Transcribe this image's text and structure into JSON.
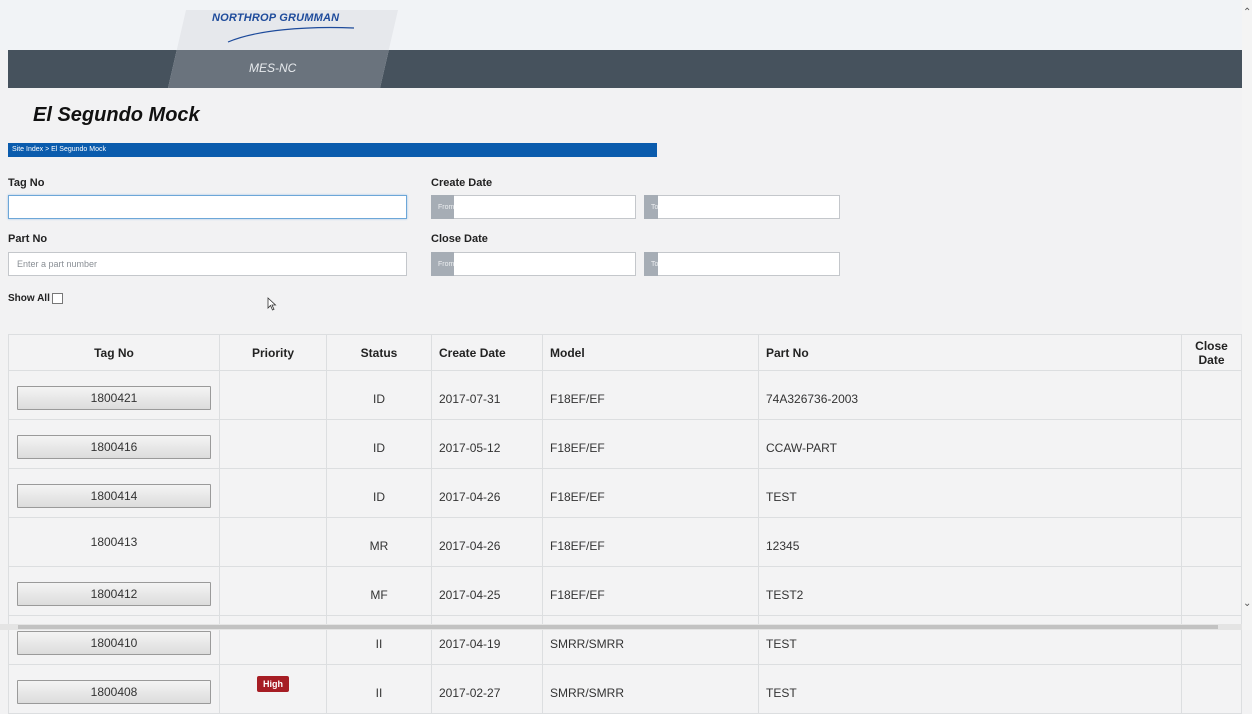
{
  "header": {
    "logo_text": "NORTHROP GRUMMAN",
    "app_name": "MES-NC"
  },
  "page": {
    "title": "El Segundo Mock",
    "breadcrumb": "Site Index > El Segundo Mock"
  },
  "filters": {
    "tag_no_label": "Tag No",
    "tag_no_value": "",
    "part_no_label": "Part No",
    "part_no_placeholder": "Enter a part number",
    "create_date_label": "Create Date",
    "close_date_label": "Close Date",
    "from_label": "From",
    "to_label": "To",
    "show_all_label": "Show All",
    "show_all_checked": false
  },
  "table": {
    "headers": [
      "Tag No",
      "Priority",
      "Status",
      "Create Date",
      "Model",
      "Part No",
      "Close Date"
    ],
    "rows": [
      {
        "tag": "1800421",
        "tag_button": true,
        "priority": "",
        "status": "ID",
        "create_date": "2017-07-31",
        "model": "F18EF/EF",
        "part_no": "74A326736-2003",
        "close_date": ""
      },
      {
        "tag": "1800416",
        "tag_button": true,
        "priority": "",
        "status": "ID",
        "create_date": "2017-05-12",
        "model": "F18EF/EF",
        "part_no": "CCAW-PART",
        "close_date": ""
      },
      {
        "tag": "1800414",
        "tag_button": true,
        "priority": "",
        "status": "ID",
        "create_date": "2017-04-26",
        "model": "F18EF/EF",
        "part_no": "TEST",
        "close_date": ""
      },
      {
        "tag": "1800413",
        "tag_button": false,
        "priority": "",
        "status": "MR",
        "create_date": "2017-04-26",
        "model": "F18EF/EF",
        "part_no": "12345",
        "close_date": ""
      },
      {
        "tag": "1800412",
        "tag_button": true,
        "priority": "",
        "status": "MF",
        "create_date": "2017-04-25",
        "model": "F18EF/EF",
        "part_no": "TEST2",
        "close_date": ""
      },
      {
        "tag": "1800410",
        "tag_button": true,
        "priority": "",
        "status": "II",
        "create_date": "2017-04-19",
        "model": "SMRR/SMRR",
        "part_no": "TEST",
        "close_date": ""
      },
      {
        "tag": "1800408",
        "tag_button": true,
        "priority": "High",
        "status": "II",
        "create_date": "2017-02-27",
        "model": "SMRR/SMRR",
        "part_no": "TEST",
        "close_date": ""
      }
    ]
  },
  "colors": {
    "nav_bar": "#46525d",
    "breadcrumb_bar": "#0b5cad",
    "priority_high": "#a61d24",
    "logo_blue": "#1e4b9b"
  }
}
